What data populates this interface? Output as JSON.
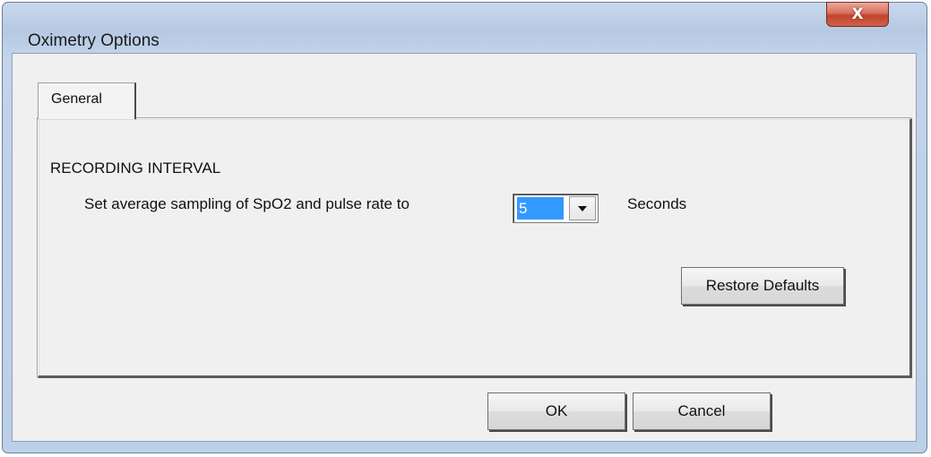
{
  "window": {
    "title": "Oximetry Options",
    "close_symbol": "X"
  },
  "tabs": [
    {
      "label": "General",
      "selected": true
    }
  ],
  "recording_interval": {
    "heading": "RECORDING INTERVAL",
    "prompt": "Set average sampling of SpO2 and pulse rate to",
    "selected_value": "5",
    "unit": "Seconds"
  },
  "buttons": {
    "restore_defaults": "Restore Defaults",
    "ok": "OK",
    "cancel": "Cancel"
  },
  "colors": {
    "selection_highlight": "#3399ff",
    "close_button": "#c1442d",
    "dialog_background": "#f0f0f0"
  },
  "icons": {
    "close": "close-icon",
    "dropdown": "chevron-down-icon"
  }
}
